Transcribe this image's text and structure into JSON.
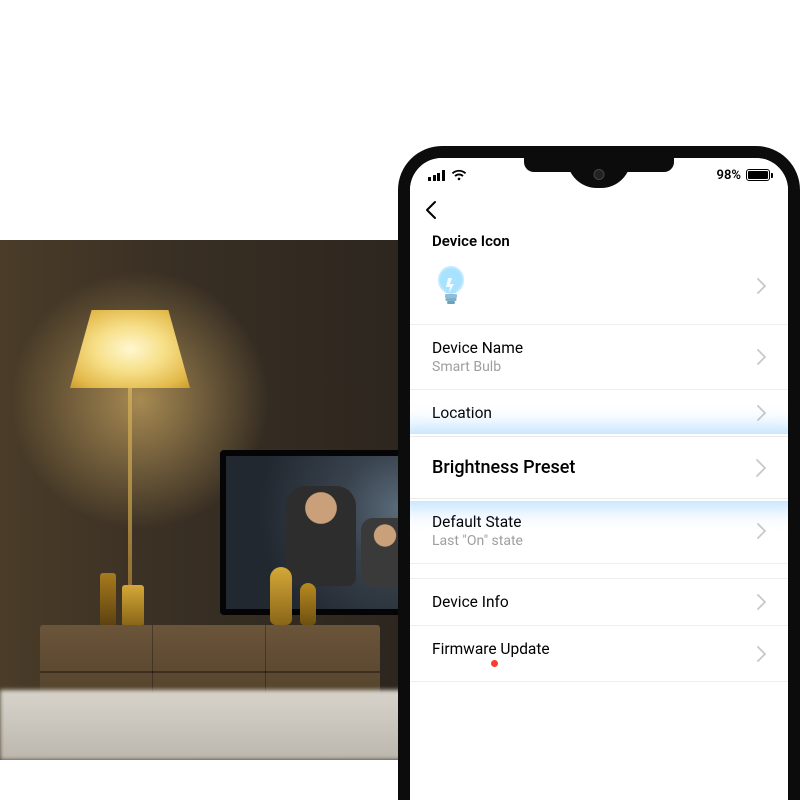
{
  "status_bar": {
    "battery_text": "98%"
  },
  "settings": {
    "section_title": "Device Icon",
    "rows": {
      "device_name": {
        "label": "Device Name",
        "value": "Smart Bulb"
      },
      "location": {
        "label": "Location"
      },
      "brightness_preset": {
        "label": "Brightness Preset"
      },
      "default_state": {
        "label": "Default State",
        "value": "Last \"On\" state"
      },
      "device_info": {
        "label": "Device Info"
      },
      "firmware_update": {
        "label": "Firmware Update",
        "has_indicator": true
      }
    }
  },
  "colors": {
    "indicator": "#ff3b30",
    "glow": "#5ab4ff"
  }
}
